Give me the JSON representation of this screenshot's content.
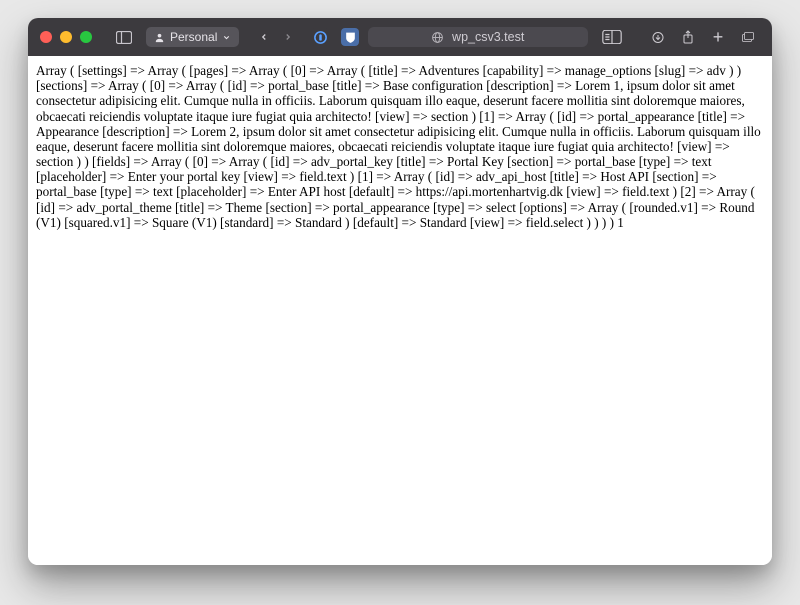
{
  "titlebar": {
    "profile_label": "Personal",
    "address_host": "wp_csv3.test"
  },
  "content": {
    "text": "Array ( [settings] => Array ( [pages] => Array ( [0] => Array ( [title] => Adventures [capability] => manage_options [slug] => adv ) ) [sections] => Array ( [0] => Array ( [id] => portal_base [title] => Base configuration [description] => Lorem 1, ipsum dolor sit amet consectetur adipisicing elit. Cumque nulla in officiis. Laborum quisquam illo eaque, deserunt facere mollitia sint doloremque maiores, obcaecati reiciendis voluptate itaque iure fugiat quia architecto! [view] => section ) [1] => Array ( [id] => portal_appearance [title] => Appearance [description] => Lorem 2, ipsum dolor sit amet consectetur adipisicing elit. Cumque nulla in officiis. Laborum quisquam illo eaque, deserunt facere mollitia sint doloremque maiores, obcaecati reiciendis voluptate itaque iure fugiat quia architecto! [view] => section ) ) [fields] => Array ( [0] => Array ( [id] => adv_portal_key [title] => Portal Key [section] => portal_base [type] => text [placeholder] => Enter your portal key [view] => field.text ) [1] => Array ( [id] => adv_api_host [title] => Host API [section] => portal_base [type] => text [placeholder] => Enter API host [default] => https://api.mortenhartvig.dk [view] => field.text ) [2] => Array ( [id] => adv_portal_theme [title] => Theme [section] => portal_appearance [type] => select [options] => Array ( [rounded.v1] => Round (V1) [squared.v1] => Square (V1) [standard] => Standard ) [default] => Standard [view] => field.select ) ) ) ) 1"
  }
}
